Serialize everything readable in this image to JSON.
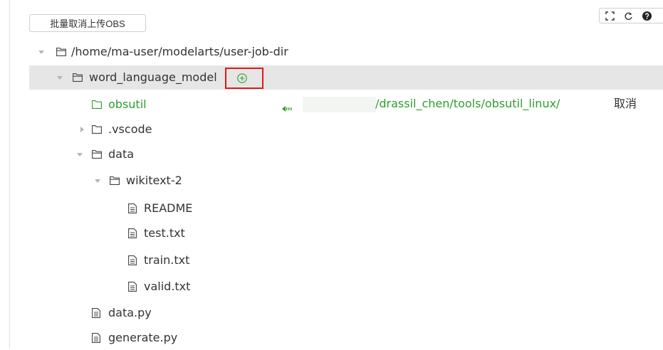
{
  "toolbar": {
    "batch_cancel_label": "批量取消上传OBS",
    "icons": [
      "fullscreen-icon",
      "refresh-icon",
      "help-icon"
    ]
  },
  "tree": {
    "root": "/home/ma-user/modelarts/user-job-dir",
    "selected_folder": "word_language_model",
    "uploading": {
      "name": "obsutil",
      "target_path": "/drassil_chen/tools/obsutil_linux/",
      "cancel_label": "取消"
    },
    "items": [
      ".vscode",
      "data",
      "wikitext-2",
      "README",
      "test.txt",
      "train.txt",
      "valid.txt",
      "data.py",
      "generate.py"
    ]
  },
  "colors": {
    "uploading": "#2e9e2e",
    "highlight": "#e01a1a",
    "selected_row": "#e6e6e6"
  }
}
